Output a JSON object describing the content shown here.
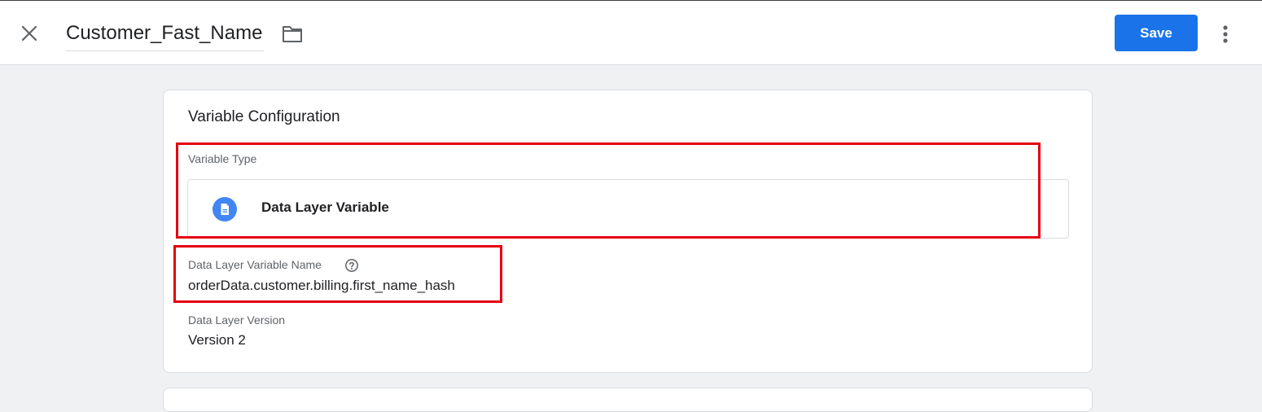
{
  "header": {
    "title": "Customer_Fast_Name",
    "save_label": "Save",
    "close_icon": "close-icon",
    "folder_icon": "folder-icon",
    "more_icon": "more-vert-icon"
  },
  "card": {
    "title": "Variable Configuration",
    "variable_type": {
      "label": "Variable Type",
      "value": "Data Layer Variable",
      "icon": "document-icon"
    },
    "variable_name": {
      "label": "Data Layer Variable Name",
      "value": "orderData.customer.billing.first_name_hash",
      "help_icon": "help-icon"
    },
    "version": {
      "label": "Data Layer Version",
      "value": "Version 2"
    }
  },
  "colors": {
    "accent": "#1a73e8",
    "highlight": "#e5000e",
    "background": "#f0f1f3"
  }
}
